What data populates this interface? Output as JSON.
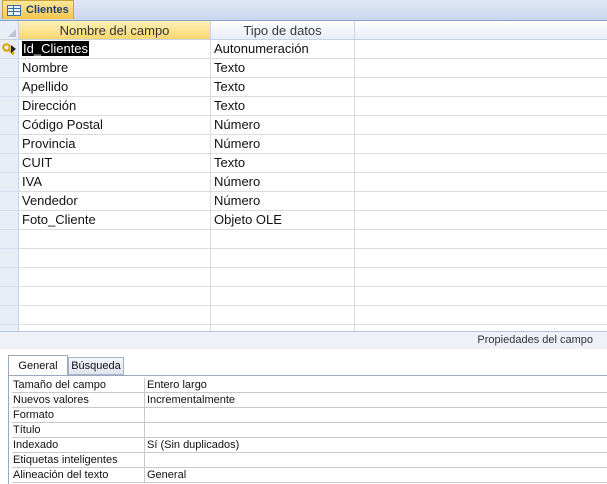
{
  "tab": {
    "title": "Clientes",
    "icon": "table-icon"
  },
  "grid": {
    "columns": [
      "Nombre del campo",
      "Tipo de datos"
    ],
    "rows": [
      {
        "name": "Id_Clientes",
        "type": "Autonumeración",
        "primary_key": true
      },
      {
        "name": "Nombre",
        "type": "Texto"
      },
      {
        "name": "Apellido",
        "type": "Texto"
      },
      {
        "name": "Dirección",
        "type": "Texto"
      },
      {
        "name": "Código Postal",
        "type": "Número"
      },
      {
        "name": "Provincia",
        "type": "Número"
      },
      {
        "name": "CUIT",
        "type": "Texto"
      },
      {
        "name": "IVA",
        "type": "Número"
      },
      {
        "name": "Vendedor",
        "type": "Número"
      },
      {
        "name": "Foto_Cliente",
        "type": "Objeto OLE"
      }
    ],
    "empty_rows": 6
  },
  "properties": {
    "title": "Propiedades del campo",
    "tabs": [
      "General",
      "Búsqueda"
    ],
    "active_tab": "General",
    "rows": [
      {
        "label": "Tamaño del campo",
        "value": "Entero largo"
      },
      {
        "label": "Nuevos valores",
        "value": "Incrementalmente"
      },
      {
        "label": "Formato",
        "value": ""
      },
      {
        "label": "Título",
        "value": ""
      },
      {
        "label": "Indexado",
        "value": "Sí (Sin duplicados)"
      },
      {
        "label": "Etiquetas inteligentes",
        "value": ""
      },
      {
        "label": "Alineación del texto",
        "value": "General"
      }
    ]
  },
  "colors": {
    "selected_header": "#f7d66d",
    "key": "#d9a400"
  }
}
